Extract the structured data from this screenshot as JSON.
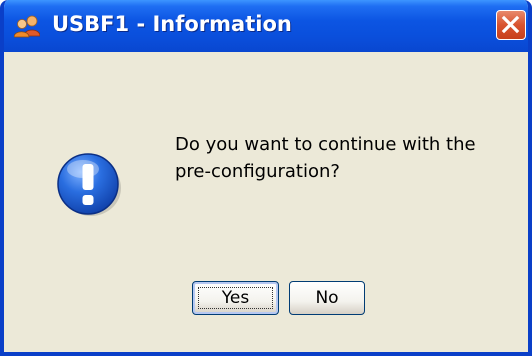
{
  "window": {
    "title": "USBF1 - Information",
    "close_icon": "close-icon",
    "app_icon": "users-icon"
  },
  "dialog": {
    "icon": "information-exclamation-icon",
    "message_line1": "Do you want to continue with the",
    "message_line2": "pre-configuration?"
  },
  "buttons": {
    "yes_label": "Yes",
    "no_label": "No"
  },
  "colors": {
    "titlebar": "#0a4fdc",
    "close_button": "#d8532f",
    "dialog_background": "#ece9d8",
    "icon_blue": "#1d5fd6"
  }
}
